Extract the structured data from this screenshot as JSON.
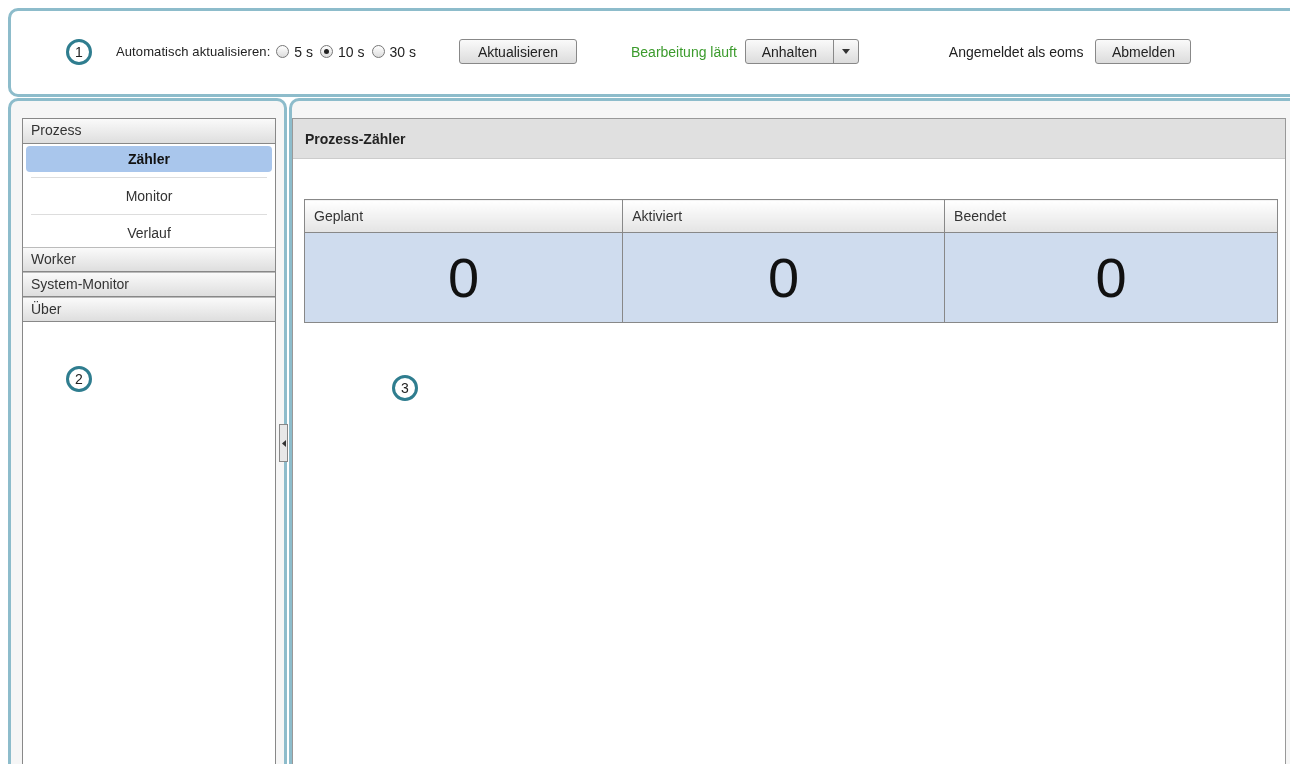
{
  "toolbar": {
    "callout": "1",
    "auto_refresh_label": "Automatisch aktualisieren:",
    "intervals": [
      {
        "label": "5 s",
        "selected": false
      },
      {
        "label": "10 s",
        "selected": true
      },
      {
        "label": "30 s",
        "selected": false
      }
    ],
    "refresh_button": "Aktualisieren",
    "status": "Bearbeitung läuft",
    "pause_button": "Anhalten",
    "logged_in": "Angemeldet als eoms",
    "logout_button": "Abmelden"
  },
  "sidebar": {
    "callout": "2",
    "sections": [
      {
        "label": "Prozess",
        "expanded": true,
        "items": [
          {
            "label": "Zähler",
            "selected": true
          },
          {
            "label": "Monitor",
            "selected": false
          },
          {
            "label": "Verlauf",
            "selected": false
          }
        ]
      },
      {
        "label": "Worker"
      },
      {
        "label": "System-Monitor"
      },
      {
        "label": "Über"
      }
    ]
  },
  "main": {
    "callout": "3",
    "title": "Prozess-Zähler",
    "table": {
      "columns": [
        "Geplant",
        "Aktiviert",
        "Beendet"
      ],
      "rows": [
        [
          "0",
          "0",
          "0"
        ]
      ]
    }
  }
}
